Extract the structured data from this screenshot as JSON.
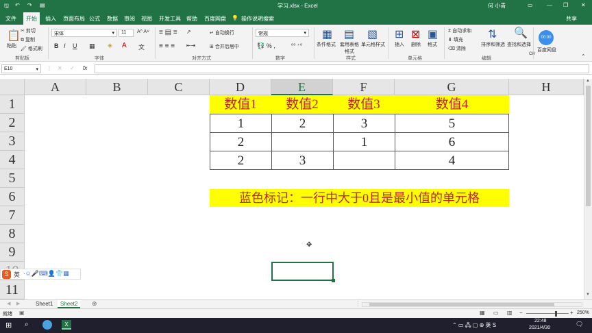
{
  "window": {
    "title": "学习.xlsx - Excel",
    "user": "何 小青",
    "share": "共享"
  },
  "tabs": [
    "文件",
    "开始",
    "插入",
    "页面布局",
    "公式",
    "数据",
    "审阅",
    "视图",
    "开发工具",
    "帮助",
    "百度网盘"
  ],
  "tell_me": "操作说明搜索",
  "clipboard": {
    "paste": "粘贴",
    "cut": "剪切",
    "copy": "复制",
    "painter": "格式刷",
    "group": "剪贴板"
  },
  "font": {
    "name": "宋体",
    "size": "11",
    "bold": "B",
    "italic": "I",
    "underline": "U",
    "group": "字体"
  },
  "alignment": {
    "wrap": "自动换行",
    "merge": "合并后居中",
    "group": "对齐方式"
  },
  "number": {
    "format": "常规",
    "group": "数字"
  },
  "styles": {
    "cond": "条件格式",
    "table": "套用表格格式",
    "cell": "单元格样式",
    "group": "样式"
  },
  "cells": {
    "insert": "插入",
    "delete": "删除",
    "format": "格式",
    "group": "单元格"
  },
  "editing": {
    "autosum": "自动求和",
    "fill": "填充",
    "clear": "清除",
    "sort": "排序和筛选",
    "find": "查找和选择",
    "group": "编辑"
  },
  "cloud": {
    "label": "百度网盘",
    "time": "00:00"
  },
  "ime_label": "CH",
  "namebox": "E10",
  "fx": "fx",
  "columns": [
    "A",
    "B",
    "C",
    "D",
    "E",
    "F",
    "G",
    "H"
  ],
  "rows": [
    "1",
    "2",
    "3",
    "4",
    "5",
    "6",
    "7",
    "8",
    "9",
    "10",
    "11"
  ],
  "table": {
    "headers": [
      "数值1",
      "数值2",
      "数值3",
      "数值4"
    ],
    "r2": [
      "1",
      "2",
      "3",
      "5"
    ],
    "r3": [
      "2",
      "",
      "1",
      "6"
    ],
    "r4": [
      "2",
      "3",
      "",
      "4"
    ]
  },
  "note": "蓝色标记：一行中大于0且是最小值的单元格",
  "ime_toolbar": "英",
  "sheets": [
    "Sheet1",
    "Sheet2"
  ],
  "status": {
    "ready": "就绪",
    "zoom": "250%"
  },
  "clock": {
    "time": "22:48",
    "date": "2021/4/30"
  }
}
